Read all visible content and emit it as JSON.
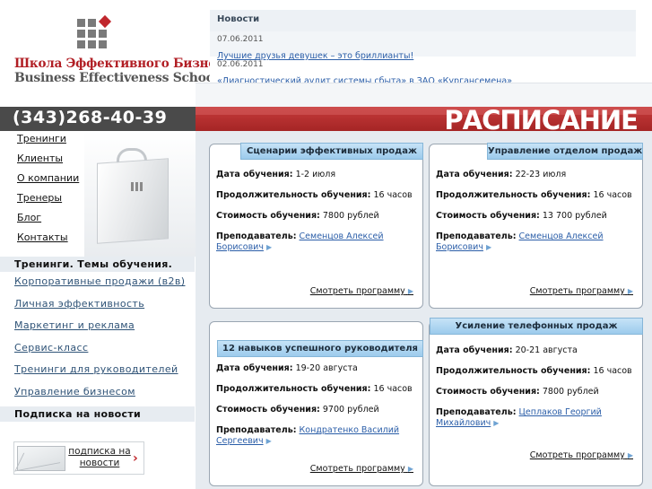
{
  "logo": {
    "title_ru": "Школа Эффективного Бизнеса",
    "title_en": "Business Effectiveness School"
  },
  "news": {
    "heading": "Новости",
    "items": [
      {
        "date": "07.06.2011",
        "title": "Лучшие друзья девушек – это бриллианты!"
      },
      {
        "date": "02.06.2011",
        "title": "«Диагностический аудит системы сбыта» в ЗАО «Кургансемена»"
      }
    ]
  },
  "header": {
    "phone": "(343)268-40-39",
    "schedule": "РАСПИСАНИЕ"
  },
  "nav": {
    "items": [
      "Тренинги",
      "Клиенты",
      "О компании",
      "Тренеры",
      "Блог",
      "Контакты"
    ]
  },
  "sidebar": {
    "categories_heading": "Тренинги. Темы обучения.",
    "categories": [
      "Корпоративные продажи (в2в)",
      "Личная эффективность",
      "Маркетинг и реклама",
      "Сервис-класс",
      "Тренинги для руководителей",
      "Управление бизнесом"
    ],
    "subscribe_heading": "Подписка на новости",
    "subscribe_button": "подписка на новости"
  },
  "labels": {
    "date": "Дата обучения:",
    "duration": "Продолжительность обучения:",
    "price": "Стоимость обучения:",
    "teacher": "Преподаватель:",
    "more": "Смотреть программу"
  },
  "trainings": [
    {
      "title": "Сценарии эффективных продаж",
      "date": "1-2 июля",
      "duration": "16 часов",
      "price": "7800 рублей",
      "teacher": "Семенцов Алексей Борисович"
    },
    {
      "title": "Управление отделом продаж",
      "date": "22-23 июля",
      "duration": "16 часов",
      "price": "13 700 рублей",
      "teacher": "Семенцов Алексей Борисович"
    },
    {
      "title": "12 навыков успешного руководителя",
      "date": "19-20 августа",
      "duration": "16 часов",
      "price": "9700 рублей",
      "teacher": "Кондратенко Василий Сергеевич"
    },
    {
      "title": "Усиление телефонных продаж",
      "date": "20-21 августа",
      "duration": "16 часов",
      "price": "7800 рублей",
      "teacher": "Цеплаков Георгий Михайлович"
    }
  ],
  "colors": {
    "brand_red": "#c0272d",
    "link_blue": "#2b5ea8",
    "card_header": "#9ccbec"
  }
}
